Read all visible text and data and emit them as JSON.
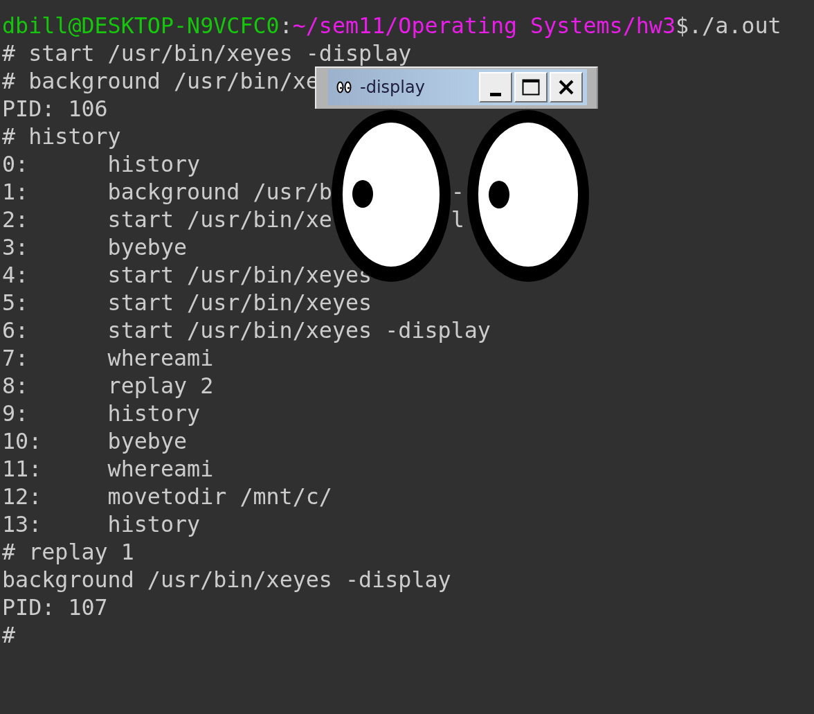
{
  "terminal": {
    "lines": [
      {
        "kind": "prompt",
        "user": "dbill@DESKTOP-N9VCFC0",
        "separator": ":",
        "path": "~/sem11/Operating Systems/hw3",
        "command": "$./a.out"
      },
      {
        "kind": "text",
        "text": "# start /usr/bin/xeyes -display"
      },
      {
        "kind": "text",
        "text": "# background /usr/bin/xe"
      },
      {
        "kind": "text",
        "text": "PID: 106"
      },
      {
        "kind": "text",
        "text": "# history"
      },
      {
        "kind": "history",
        "index": "0:",
        "command": "history"
      },
      {
        "kind": "history",
        "index": "1:",
        "command": "background /usr/b",
        "trail": "-"
      },
      {
        "kind": "history",
        "index": "2:",
        "command": "start /usr/bin/xe",
        "trail": "l"
      },
      {
        "kind": "history",
        "index": "3:",
        "command": "byebye"
      },
      {
        "kind": "history",
        "index": "4:",
        "command": "start /usr/bin/xeyes"
      },
      {
        "kind": "history",
        "index": "5:",
        "command": "start /usr/bin/xeyes"
      },
      {
        "kind": "history",
        "index": "6:",
        "command": "start /usr/bin/xeyes -display"
      },
      {
        "kind": "history",
        "index": "7:",
        "command": "whereami"
      },
      {
        "kind": "history",
        "index": "8:",
        "command": "replay 2"
      },
      {
        "kind": "history",
        "index": "9:",
        "command": "history"
      },
      {
        "kind": "history",
        "index": "10:",
        "command": "byebye"
      },
      {
        "kind": "history",
        "index": "11:",
        "command": "whereami"
      },
      {
        "kind": "history",
        "index": "12:",
        "command": "movetodir /mnt/c/"
      },
      {
        "kind": "history",
        "index": "13:",
        "command": "history"
      },
      {
        "kind": "text",
        "text": "# replay 1"
      },
      {
        "kind": "text",
        "text": "background /usr/bin/xeyes -display"
      },
      {
        "kind": "text",
        "text": "PID: 107"
      },
      {
        "kind": "text",
        "text": "#"
      }
    ]
  },
  "xeyes_window": {
    "title": "-display"
  }
}
